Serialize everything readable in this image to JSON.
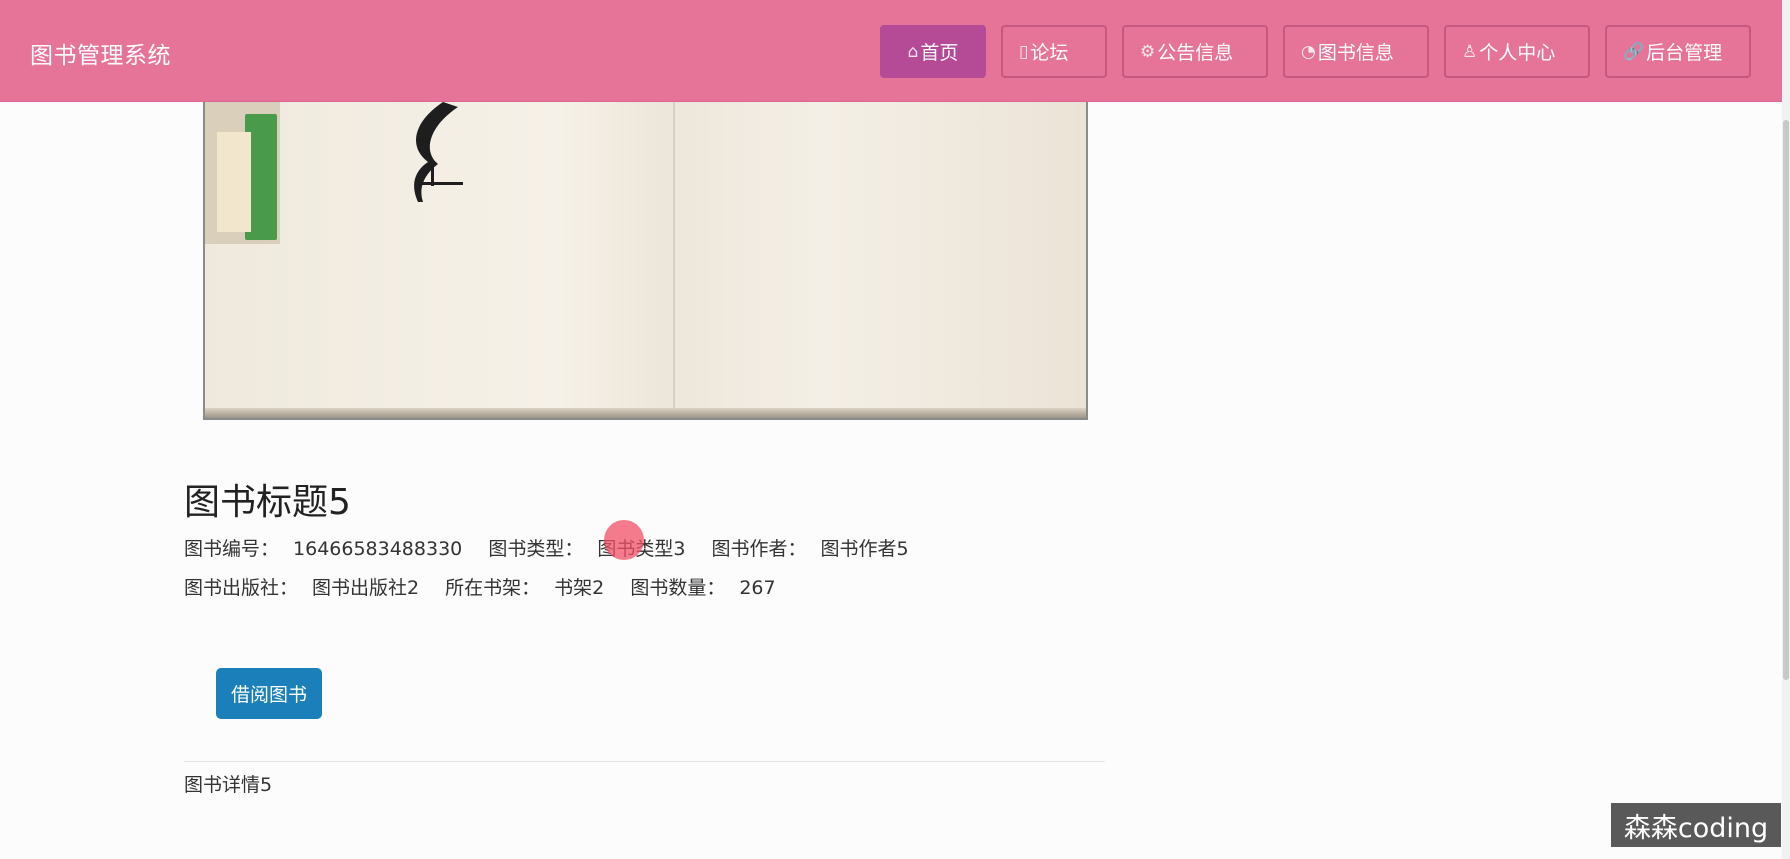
{
  "header": {
    "brand": "图书管理系统",
    "nav": [
      {
        "icon": "⌂",
        "label": "首页",
        "active": true
      },
      {
        "icon": "▯",
        "label": "论坛"
      },
      {
        "icon": "⚙",
        "label": "公告信息"
      },
      {
        "icon": "◔",
        "label": "图书信息"
      },
      {
        "icon": "♙",
        "label": "个人中心"
      },
      {
        "icon": "🔗",
        "label": "后台管理"
      }
    ]
  },
  "book": {
    "title": "图书标题5",
    "fields_row1": [
      {
        "label": "图书编号：",
        "value": "16466583488330"
      },
      {
        "label": "图书类型：",
        "value": "图书类型3"
      },
      {
        "label": "图书作者：",
        "value": "图书作者5"
      }
    ],
    "fields_row2": [
      {
        "label": "图书出版社：",
        "value": "图书出版社2"
      },
      {
        "label": "所在书架：",
        "value": "书架2"
      },
      {
        "label": "图书数量：",
        "value": "267"
      }
    ],
    "borrow_button": "借阅图书",
    "details": "图书详情5"
  },
  "watermark": "森森coding",
  "colors": {
    "navbar": "#e67499",
    "nav_active": "#b54a97",
    "primary_button": "#1b7fb9"
  }
}
